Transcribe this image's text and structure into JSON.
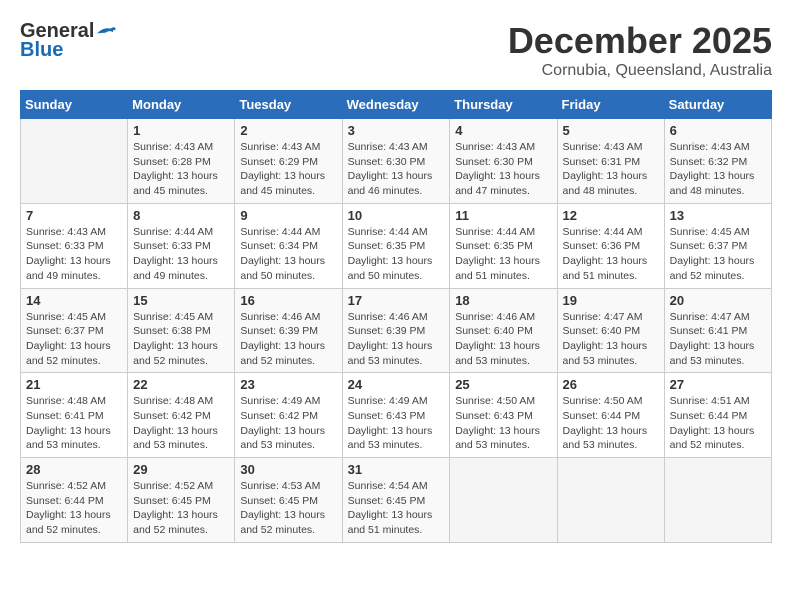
{
  "logo": {
    "line1": "General",
    "line2": "Blue"
  },
  "title": "December 2025",
  "subtitle": "Cornubia, Queensland, Australia",
  "weekdays": [
    "Sunday",
    "Monday",
    "Tuesday",
    "Wednesday",
    "Thursday",
    "Friday",
    "Saturday"
  ],
  "weeks": [
    [
      {
        "day": "",
        "info": ""
      },
      {
        "day": "1",
        "info": "Sunrise: 4:43 AM\nSunset: 6:28 PM\nDaylight: 13 hours\nand 45 minutes."
      },
      {
        "day": "2",
        "info": "Sunrise: 4:43 AM\nSunset: 6:29 PM\nDaylight: 13 hours\nand 45 minutes."
      },
      {
        "day": "3",
        "info": "Sunrise: 4:43 AM\nSunset: 6:30 PM\nDaylight: 13 hours\nand 46 minutes."
      },
      {
        "day": "4",
        "info": "Sunrise: 4:43 AM\nSunset: 6:30 PM\nDaylight: 13 hours\nand 47 minutes."
      },
      {
        "day": "5",
        "info": "Sunrise: 4:43 AM\nSunset: 6:31 PM\nDaylight: 13 hours\nand 48 minutes."
      },
      {
        "day": "6",
        "info": "Sunrise: 4:43 AM\nSunset: 6:32 PM\nDaylight: 13 hours\nand 48 minutes."
      }
    ],
    [
      {
        "day": "7",
        "info": "Sunrise: 4:43 AM\nSunset: 6:33 PM\nDaylight: 13 hours\nand 49 minutes."
      },
      {
        "day": "8",
        "info": "Sunrise: 4:44 AM\nSunset: 6:33 PM\nDaylight: 13 hours\nand 49 minutes."
      },
      {
        "day": "9",
        "info": "Sunrise: 4:44 AM\nSunset: 6:34 PM\nDaylight: 13 hours\nand 50 minutes."
      },
      {
        "day": "10",
        "info": "Sunrise: 4:44 AM\nSunset: 6:35 PM\nDaylight: 13 hours\nand 50 minutes."
      },
      {
        "day": "11",
        "info": "Sunrise: 4:44 AM\nSunset: 6:35 PM\nDaylight: 13 hours\nand 51 minutes."
      },
      {
        "day": "12",
        "info": "Sunrise: 4:44 AM\nSunset: 6:36 PM\nDaylight: 13 hours\nand 51 minutes."
      },
      {
        "day": "13",
        "info": "Sunrise: 4:45 AM\nSunset: 6:37 PM\nDaylight: 13 hours\nand 52 minutes."
      }
    ],
    [
      {
        "day": "14",
        "info": "Sunrise: 4:45 AM\nSunset: 6:37 PM\nDaylight: 13 hours\nand 52 minutes."
      },
      {
        "day": "15",
        "info": "Sunrise: 4:45 AM\nSunset: 6:38 PM\nDaylight: 13 hours\nand 52 minutes."
      },
      {
        "day": "16",
        "info": "Sunrise: 4:46 AM\nSunset: 6:39 PM\nDaylight: 13 hours\nand 52 minutes."
      },
      {
        "day": "17",
        "info": "Sunrise: 4:46 AM\nSunset: 6:39 PM\nDaylight: 13 hours\nand 53 minutes."
      },
      {
        "day": "18",
        "info": "Sunrise: 4:46 AM\nSunset: 6:40 PM\nDaylight: 13 hours\nand 53 minutes."
      },
      {
        "day": "19",
        "info": "Sunrise: 4:47 AM\nSunset: 6:40 PM\nDaylight: 13 hours\nand 53 minutes."
      },
      {
        "day": "20",
        "info": "Sunrise: 4:47 AM\nSunset: 6:41 PM\nDaylight: 13 hours\nand 53 minutes."
      }
    ],
    [
      {
        "day": "21",
        "info": "Sunrise: 4:48 AM\nSunset: 6:41 PM\nDaylight: 13 hours\nand 53 minutes."
      },
      {
        "day": "22",
        "info": "Sunrise: 4:48 AM\nSunset: 6:42 PM\nDaylight: 13 hours\nand 53 minutes."
      },
      {
        "day": "23",
        "info": "Sunrise: 4:49 AM\nSunset: 6:42 PM\nDaylight: 13 hours\nand 53 minutes."
      },
      {
        "day": "24",
        "info": "Sunrise: 4:49 AM\nSunset: 6:43 PM\nDaylight: 13 hours\nand 53 minutes."
      },
      {
        "day": "25",
        "info": "Sunrise: 4:50 AM\nSunset: 6:43 PM\nDaylight: 13 hours\nand 53 minutes."
      },
      {
        "day": "26",
        "info": "Sunrise: 4:50 AM\nSunset: 6:44 PM\nDaylight: 13 hours\nand 53 minutes."
      },
      {
        "day": "27",
        "info": "Sunrise: 4:51 AM\nSunset: 6:44 PM\nDaylight: 13 hours\nand 52 minutes."
      }
    ],
    [
      {
        "day": "28",
        "info": "Sunrise: 4:52 AM\nSunset: 6:44 PM\nDaylight: 13 hours\nand 52 minutes."
      },
      {
        "day": "29",
        "info": "Sunrise: 4:52 AM\nSunset: 6:45 PM\nDaylight: 13 hours\nand 52 minutes."
      },
      {
        "day": "30",
        "info": "Sunrise: 4:53 AM\nSunset: 6:45 PM\nDaylight: 13 hours\nand 52 minutes."
      },
      {
        "day": "31",
        "info": "Sunrise: 4:54 AM\nSunset: 6:45 PM\nDaylight: 13 hours\nand 51 minutes."
      },
      {
        "day": "",
        "info": ""
      },
      {
        "day": "",
        "info": ""
      },
      {
        "day": "",
        "info": ""
      }
    ]
  ]
}
